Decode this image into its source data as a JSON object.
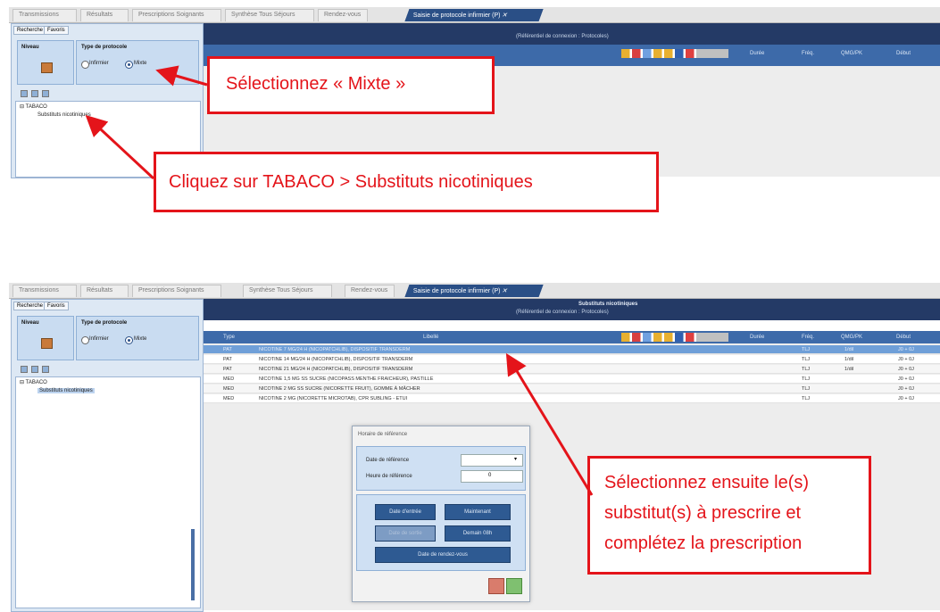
{
  "tabs": [
    "Transmissions",
    "Résultats",
    "Prescriptions Soignants",
    "Synthèse Tous Séjours",
    "Rendez-vous",
    "Saisie de protocole infirmier (P)"
  ],
  "subtabs": [
    "Recherche",
    "Favoris"
  ],
  "left": {
    "niveau_label": "Niveau",
    "type_label": "Type de protocole",
    "radio_infirmier": "Infirmier",
    "radio_mixte": "Mixte",
    "tree_root": "TABACO",
    "tree_child": "Substituts nicotiniques"
  },
  "top": {
    "header_line2": "(Référentiel de connexion : Protocoles)",
    "cols": [
      "Durée",
      "Fréq.",
      "QMG/PK",
      "Début"
    ]
  },
  "bottom": {
    "header_line1": "Substituts nicotiniques",
    "header_line2": "(Référentiel de connexion : Protocoles)",
    "cols": [
      "Type",
      "Libellé",
      "Durée",
      "Fréq.",
      "QMG/PK",
      "Début"
    ],
    "rows": [
      {
        "type": "PAT",
        "label": "NICOTINE 7 MG/24 H (NICOPATCHLIB), DISPOSITIF TRANSDERM",
        "freq": "TLJ",
        "q": "1/dil",
        "debut": "J0 + 0J"
      },
      {
        "type": "PAT",
        "label": "NICOTINE 14 MG/24 H (NICOPATCHLIB), DISPOSITIF TRANSDERM",
        "freq": "TLJ",
        "q": "1/dil",
        "debut": "J0 + 0J"
      },
      {
        "type": "PAT",
        "label": "NICOTINE 21 MG/24 H (NICOPATCHLIB), DISPOSITIF TRANSDERM",
        "freq": "TLJ",
        "q": "1/dil",
        "debut": "J0 + 0J"
      },
      {
        "type": "MED",
        "label": "NICOTINE 1,5 MG SS SUCRE (NICOPASS MENTHE FRAICHEUR), PASTILLE",
        "freq": "TLJ",
        "q": "",
        "debut": "J0 + 0J"
      },
      {
        "type": "MED",
        "label": "NICOTINE 2 MG SS SUCRE (NICORETTE FRUIT), GOMME À MÂCHER",
        "freq": "TLJ",
        "q": "",
        "debut": "J0 + 0J"
      },
      {
        "type": "MED",
        "label": "NICOTINE 2 MG (NICORETTE MICROTAB), CPR SUBLING - ETUI",
        "freq": "TLJ",
        "q": "",
        "debut": "J0 + 0J"
      }
    ]
  },
  "dialog": {
    "title": "Horaire de référence",
    "date_label": "Date de référence",
    "heure_label": "Heure de référence",
    "heure_value": "0",
    "btn_entree": "Date d'entrée",
    "btn_maintenant": "Maintenant",
    "btn_sortie": "Date de sortie",
    "btn_demain": "Demain 08h",
    "btn_rdv": "Date de rendez-vous"
  },
  "annotations": {
    "a1": "Sélectionnez « Mixte »",
    "a2": "Cliquez sur TABACO > Substituts nicotiniques",
    "a3_l1": "Sélectionnez ensuite le(s)",
    "a3_l2": "substitut(s) à prescrire et",
    "a3_l3": "complétez la prescription"
  },
  "colors": {
    "annotation": "#e4141a",
    "header": "#243a66",
    "column": "#3d6aa9",
    "selected_row": "#6f9fd8"
  }
}
